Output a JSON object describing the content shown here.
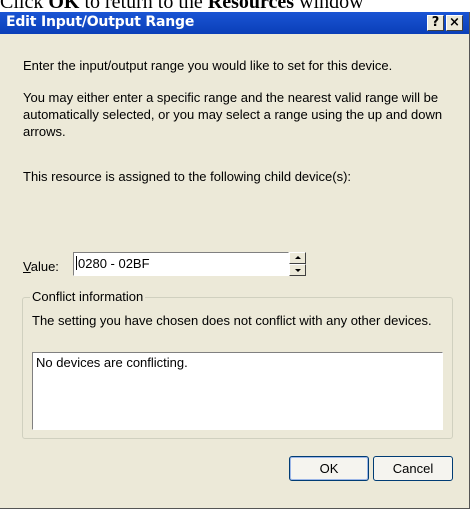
{
  "page_caption": {
    "prefix": "Click ",
    "bold1": "OK",
    "middle": " to return to the ",
    "bold2": "Resources",
    "suffix": " window"
  },
  "dialog": {
    "title": "Edit Input/Output Range",
    "help_button": "?",
    "close_button": "×",
    "intro": "Enter the input/output range you would like to set for this device.",
    "instructions": "You may either enter a specific range and the nearest valid range will be automatically selected, or you may select a range using the up and down arrows.",
    "assigned_text": "This resource is assigned to the following child device(s):",
    "value_label_prefix": "V",
    "value_label_rest": "alue:",
    "value": "0280 - 02BF",
    "conflict_group_label": "Conflict information",
    "conflict_message": "The setting you have chosen does not conflict with any other devices.",
    "conflict_list": "No devices are conflicting.",
    "ok_label": "OK",
    "cancel_label": "Cancel"
  }
}
